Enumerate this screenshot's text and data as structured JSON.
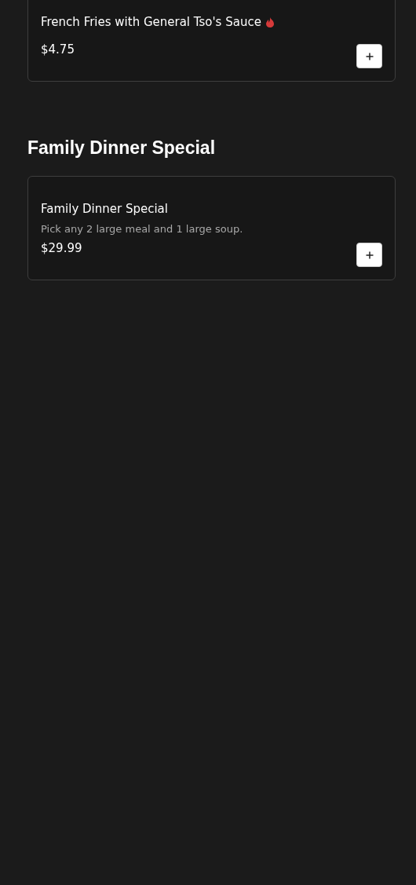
{
  "sections": [
    {
      "items": [
        {
          "name": "French Fries with General Tso's Sauce",
          "spicy": true,
          "price": "$4.75"
        }
      ]
    },
    {
      "heading": "Family Dinner Special",
      "items": [
        {
          "name": "Family Dinner Special",
          "spicy": false,
          "description": "Pick any 2 large meal and 1 large soup.",
          "price": "$29.99"
        }
      ]
    }
  ]
}
